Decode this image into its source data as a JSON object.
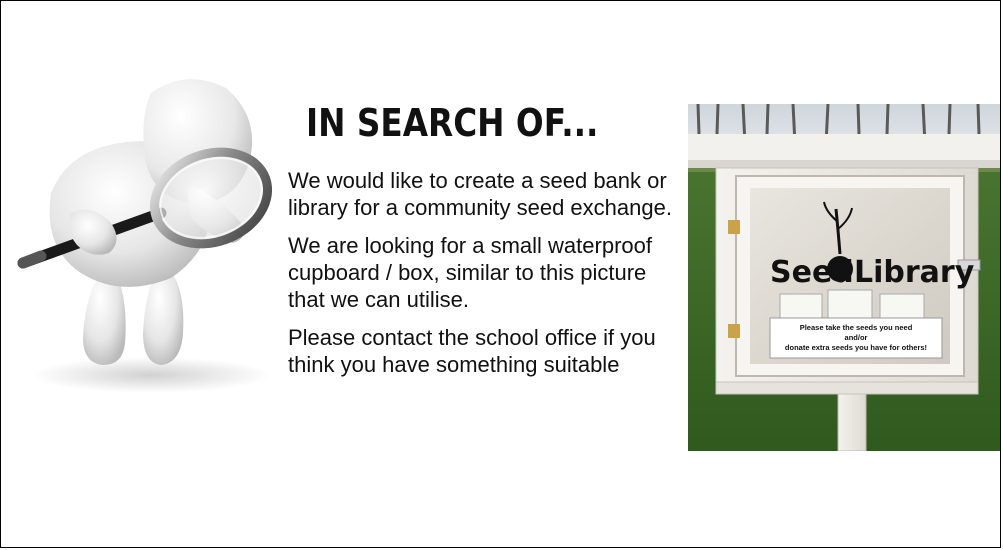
{
  "slide": {
    "title": "IN SEARCH OF...",
    "paragraphs": [
      "We would like to create a seed bank or library for a community seed exchange.",
      "We are looking for a small waterproof cupboard / box, similar to this picture that we can utilise.",
      "Please contact the school office if you think you have something suitable"
    ]
  },
  "photo": {
    "sign_text_left": "Seed",
    "sign_text_right": "Library",
    "note_line1": "Please take the seeds you need",
    "note_line2": "and/or",
    "note_line3": "donate extra seeds you have for others!"
  },
  "icons": {
    "figure": "magnifier-figure-icon",
    "photo": "seed-library-box-photo"
  }
}
